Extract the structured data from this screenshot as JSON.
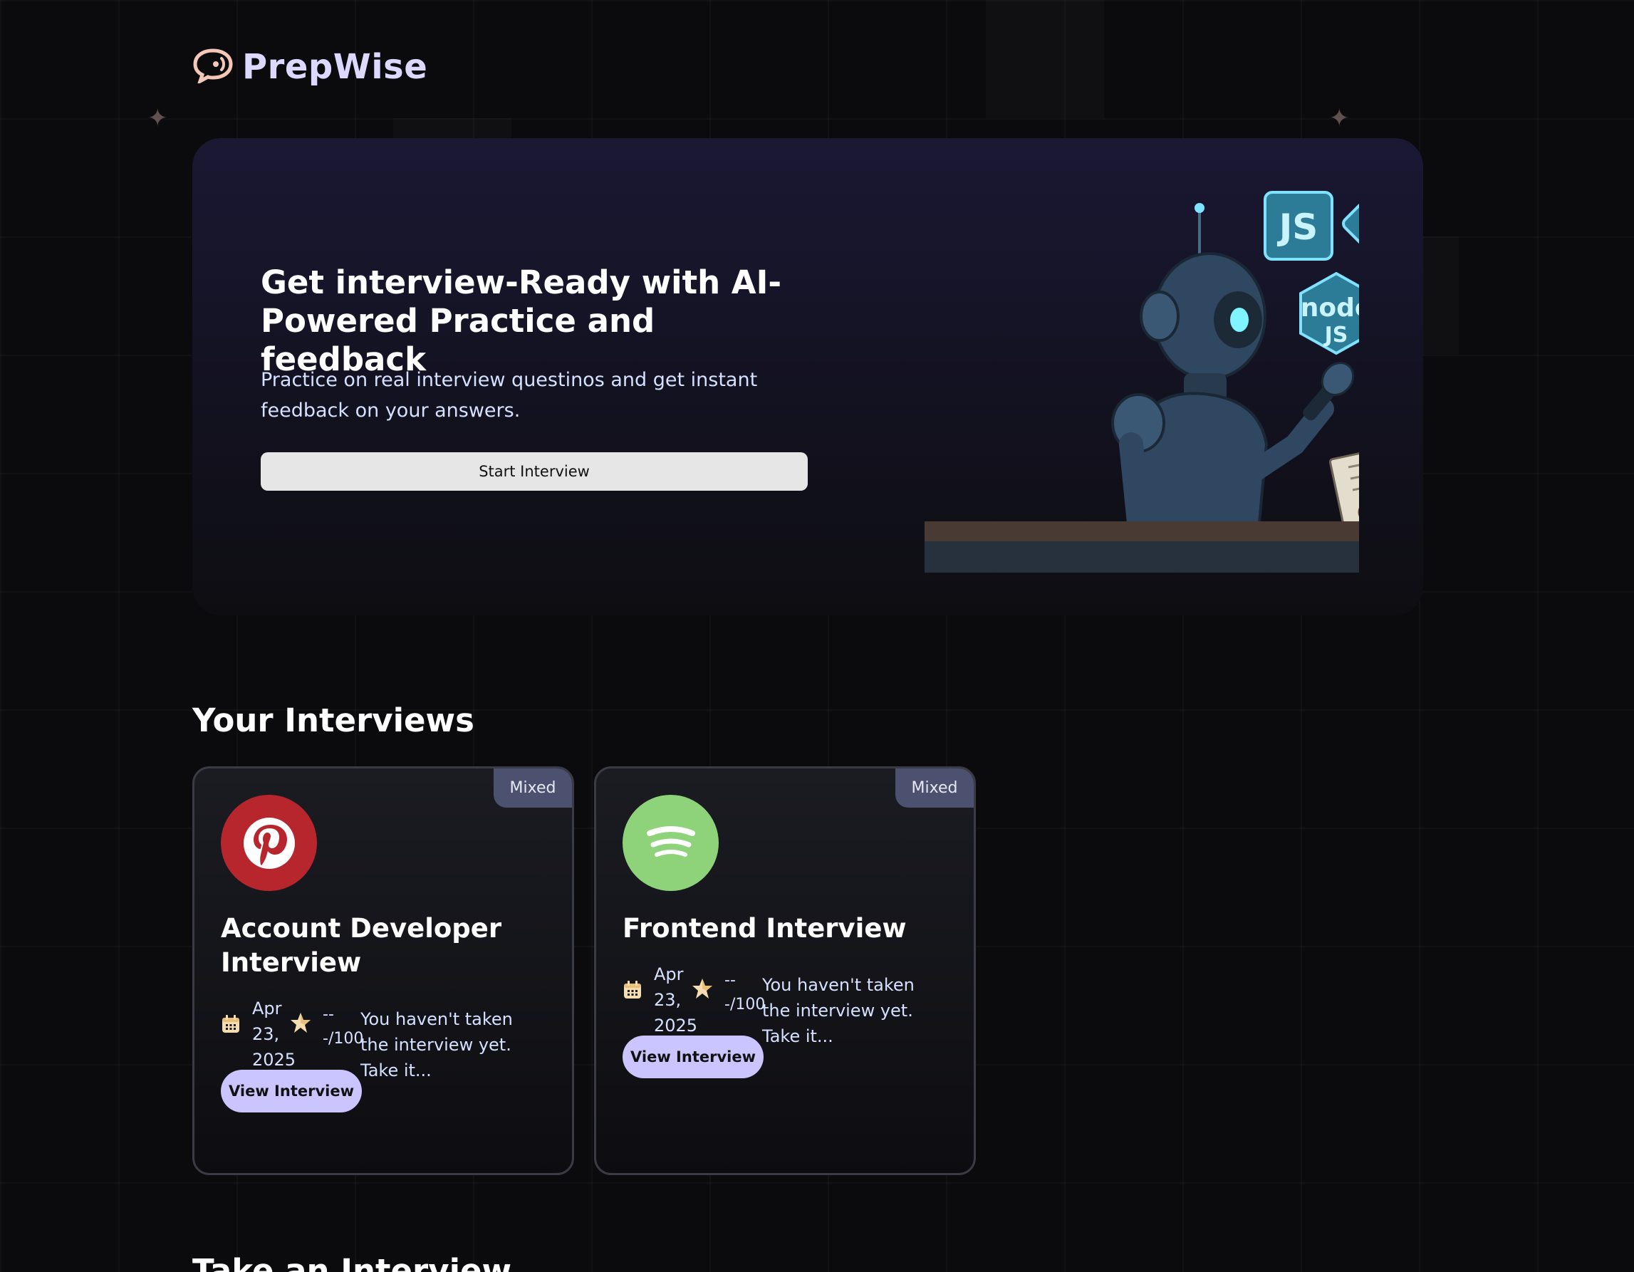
{
  "brand": {
    "name": "PrepWise",
    "logo_icon": "chat-bubble-icon",
    "accent": "#f5c7b8"
  },
  "hero": {
    "title": "Get interview-Ready with AI-Powered Practice and feedback",
    "subtitle": "Practice on real interview questinos and get instant feedback on your answers.",
    "cta_label": "Start Interview",
    "illustration": "robot-interviewer-illustration"
  },
  "interviews": {
    "section_title": "Your Interviews",
    "items": [
      {
        "badge": "Mixed",
        "company_icon": "pinterest-icon",
        "company_color": "#b8262d",
        "title": "Account Developer Interview",
        "date": "Apr 23, 2025",
        "score": "---/100",
        "description": "You haven't taken the interview yet. Take it...",
        "button_label": "View Interview"
      },
      {
        "badge": "Mixed",
        "company_icon": "spotify-icon",
        "company_color": "#8ed37a",
        "title": "Frontend Interview",
        "date": "Apr 23, 2025",
        "score": "---/100",
        "description": "You haven't taken the interview yet. Take it...",
        "button_label": "View Interview"
      }
    ]
  },
  "next_section": {
    "title": "Take an Interview"
  },
  "colors": {
    "button_primary": "#cac5fe",
    "badge_bg": "#4d5170",
    "text_muted": "#d6e0ff"
  }
}
